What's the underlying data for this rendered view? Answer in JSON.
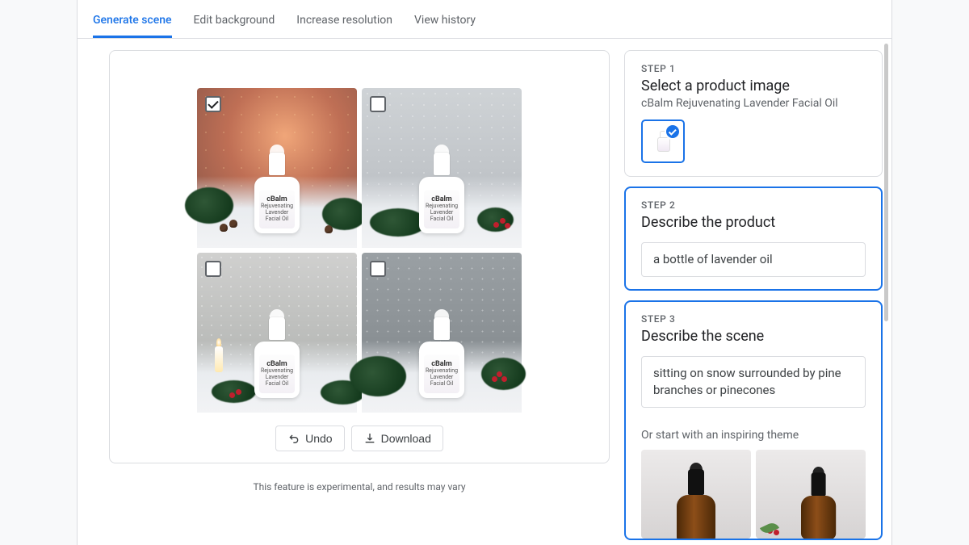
{
  "tabs": {
    "generate": "Generate scene",
    "edit_bg": "Edit background",
    "increase_res": "Increase resolution",
    "history": "View history"
  },
  "active_tab": "generate",
  "generated": {
    "selected_index": 0,
    "product_brand": "cBalm",
    "product_tag": "Rejuvenating Lavender Facial Oil"
  },
  "buttons": {
    "undo": "Undo",
    "download": "Download"
  },
  "disclaimer": "This feature is experimental, and results may vary",
  "steps": {
    "s1": {
      "label": "STEP 1",
      "title": "Select a product image",
      "product_name": "cBalm Rejuvenating Lavender Facial Oil"
    },
    "s2": {
      "label": "STEP 2",
      "title": "Describe the product",
      "value": "a bottle of lavender oil"
    },
    "s3": {
      "label": "STEP 3",
      "title": "Describe the scene",
      "value": "sitting on snow surrounded by pine branches or pinecones",
      "inspire": "Or start with an inspiring theme"
    }
  }
}
